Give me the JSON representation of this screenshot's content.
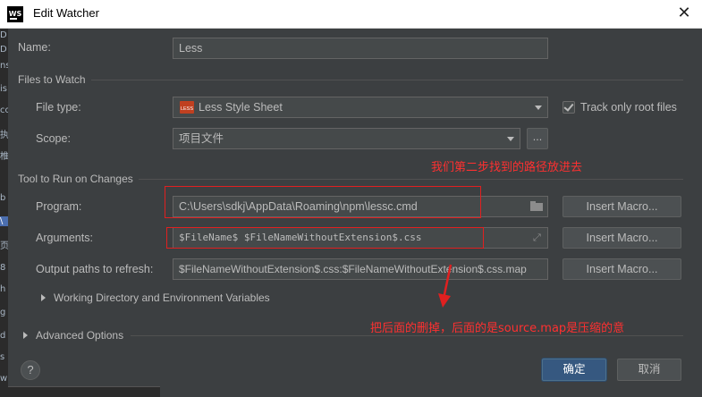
{
  "window": {
    "app_icon_text": "WS",
    "title": "Edit Watcher"
  },
  "underlay_glyphs": [
    "D",
    "D",
    "ns",
    "is",
    "co",
    "执",
    "椎",
    "b",
    "\\",
    "页",
    "8",
    "h",
    "g",
    "d",
    "s",
    "w"
  ],
  "form": {
    "name_label": "Name:",
    "name_value": "Less",
    "files_section": "Files to Watch",
    "file_type_label": "File type:",
    "file_type_icon_text": "LESS",
    "file_type_value": "Less Style Sheet",
    "track_root_label": "Track only root files",
    "track_root_checked": true,
    "scope_label": "Scope:",
    "scope_value": "项目文件",
    "scope_more": "...",
    "tool_section": "Tool to Run on Changes",
    "program_label": "Program:",
    "program_value": "C:\\Users\\sdkj\\AppData\\Roaming\\npm\\lessc.cmd",
    "arguments_label": "Arguments:",
    "arguments_value": "$FileName$ $FileNameWithoutExtension$.css",
    "output_label": "Output paths to refresh:",
    "output_value": "$FileNameWithoutExtension$.css:$FileNameWithoutExtension$.css.map",
    "insert_macro": "Insert Macro...",
    "working_dir": "Working Directory and Environment Variables",
    "advanced": "Advanced Options"
  },
  "annotations": {
    "program_note": "我们第二步找到的路径放进去",
    "output_note": "把后面的删掉，后面的是source.map是压缩的意"
  },
  "buttons": {
    "help": "?",
    "ok": "确定",
    "cancel": "取消"
  },
  "colors": {
    "annotation": "#e02020",
    "primary": "#365880"
  }
}
